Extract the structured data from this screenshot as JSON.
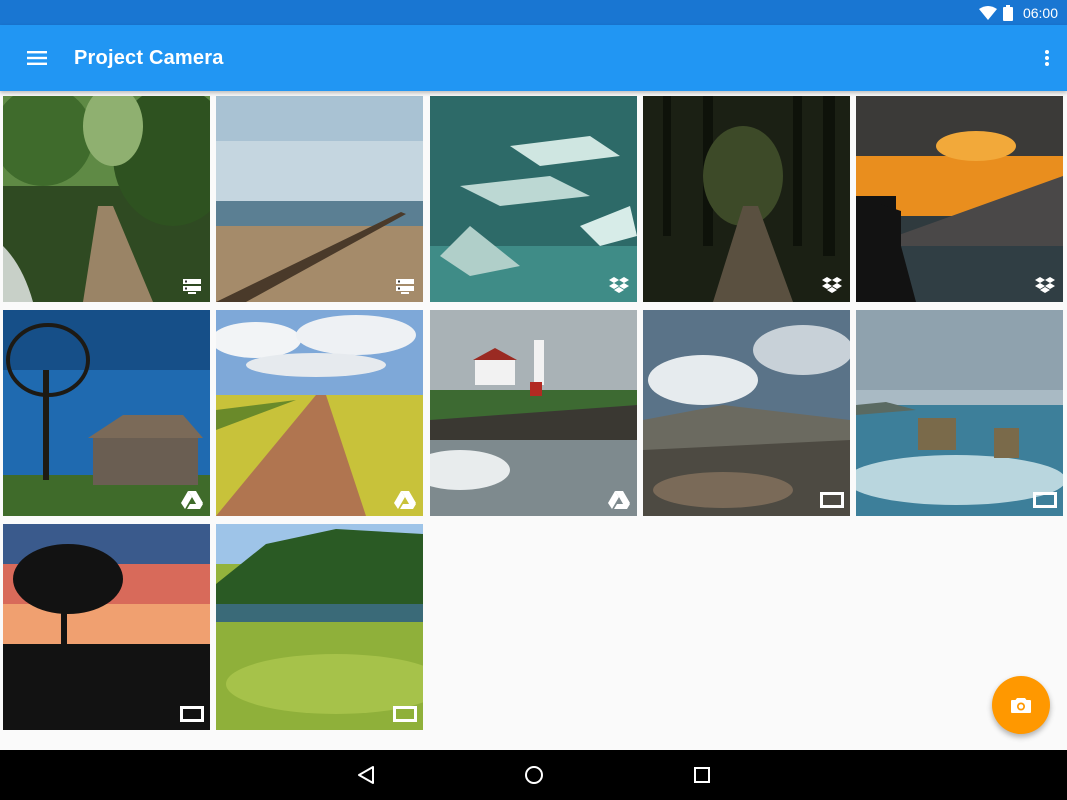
{
  "status_bar": {
    "time": "06:00",
    "icons": [
      "wifi-icon",
      "battery-icon"
    ]
  },
  "app_bar": {
    "title": "Project Camera",
    "menu_icon": "menu-icon",
    "overflow_icon": "more-vert-icon",
    "color": "#2196f3",
    "status_color": "#1976d2"
  },
  "photos": [
    {
      "subject": "forest-path",
      "source": "server-icon"
    },
    {
      "subject": "beach-groyne",
      "source": "server-icon"
    },
    {
      "subject": "stingrays",
      "source": "dropbox-icon"
    },
    {
      "subject": "dark-forest",
      "source": "dropbox-icon"
    },
    {
      "subject": "sunset-coast",
      "source": "dropbox-icon"
    },
    {
      "subject": "old-barn",
      "source": "drive-icon"
    },
    {
      "subject": "dirt-road-field",
      "source": "drive-icon"
    },
    {
      "subject": "lighthouse",
      "source": "drive-icon"
    },
    {
      "subject": "mountain-clouds",
      "source": "device-icon"
    },
    {
      "subject": "sea-stacks",
      "source": "device-icon"
    },
    {
      "subject": "sunset-tree",
      "source": "device-icon"
    },
    {
      "subject": "green-meadow",
      "source": "device-icon"
    }
  ],
  "fab": {
    "icon": "camera-icon",
    "color": "#ff9800"
  },
  "nav_bar": {
    "icons": [
      "back-icon",
      "home-icon",
      "recents-icon"
    ]
  }
}
